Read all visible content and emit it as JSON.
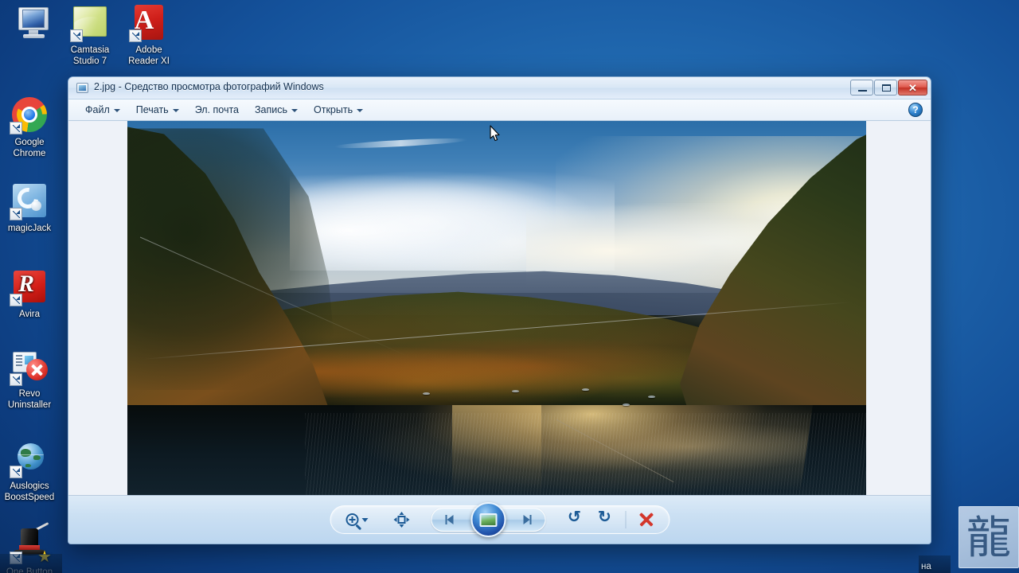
{
  "desktop": {
    "icons": [
      {
        "label": "Компьютер",
        "icon": "computer-icon",
        "shortcut": false
      },
      {
        "label": "Camtasia\nStudio 7",
        "label_line1": "Camtasia",
        "label_line2": "Studio 7",
        "icon": "camtasia-studio-icon",
        "shortcut": true
      },
      {
        "label": "Adobe\nReader XI",
        "label_line1": "Adobe",
        "label_line2": "Reader XI",
        "icon": "adobe-reader-icon",
        "shortcut": true
      },
      {
        "label": "Google\nChrome",
        "label_line1": "Google",
        "label_line2": "Chrome",
        "icon": "google-chrome-icon",
        "shortcut": true
      },
      {
        "label": "magicJack",
        "label_line1": "magicJack",
        "label_line2": "",
        "icon": "magicjack-icon",
        "shortcut": true
      },
      {
        "label": "Avira",
        "label_line1": "Avira",
        "label_line2": "",
        "icon": "avira-icon",
        "shortcut": true
      },
      {
        "label": "Revo\nUninstaller",
        "label_line1": "Revo",
        "label_line2": "Uninstaller",
        "icon": "revo-uninstaller-icon",
        "shortcut": true
      },
      {
        "label": "Auslogics\nBoostSpeed",
        "label_line1": "Auslogics",
        "label_line2": "BoostSpeed",
        "icon": "auslogics-boostspeed-icon",
        "shortcut": true
      },
      {
        "label": "One Button",
        "label_line1": "One Button",
        "label_line2": "",
        "icon": "one-button-icon",
        "shortcut": true
      }
    ],
    "gadget": {
      "name": "dragon-gadget",
      "glyph": "龍"
    },
    "taskbar_fragment_left": "",
    "taskbar_fragment_right": "на"
  },
  "window": {
    "title": "2.jpg - Средство просмотра фотографий Windows",
    "file_name": "2.jpg",
    "app_name": "Средство просмотра фотографий Windows",
    "controls": {
      "minimize": "Свернуть",
      "maximize": "Развернуть",
      "close": "Закрыть",
      "close_glyph": "✕"
    },
    "menu": [
      {
        "label": "Файл",
        "has_caret": true
      },
      {
        "label": "Печать",
        "has_caret": true
      },
      {
        "label": "Эл. почта",
        "has_caret": false
      },
      {
        "label": "Запись",
        "has_caret": true
      },
      {
        "label": "Открыть",
        "has_caret": true
      }
    ],
    "help": {
      "label": "Справка",
      "glyph": "?"
    },
    "toolbar": {
      "zoom": "Увеличить",
      "fit_to_window": "По размеру окна",
      "previous": "Предыдущее",
      "slideshow": "Показ слайдов",
      "next": "Следующее",
      "rotate_left": "Повернуть против часовой стрелки",
      "rotate_right": "Повернуть по часовой стрелке",
      "delete": "Удалить",
      "rotate_left_glyph": "↺",
      "rotate_right_glyph": "↻"
    },
    "photo": {
      "description": "Осенний пейзаж: озеро, лесистые холмы, закатное небо с облаками",
      "alt": "autumn-lake-landscape"
    }
  },
  "colors": {
    "desktop_blue": "#14519a",
    "window_chrome": "#dbe8f5",
    "close_red": "#c33225",
    "accent_blue": "#1d5b96",
    "canvas_matte": "#eef2f8"
  }
}
